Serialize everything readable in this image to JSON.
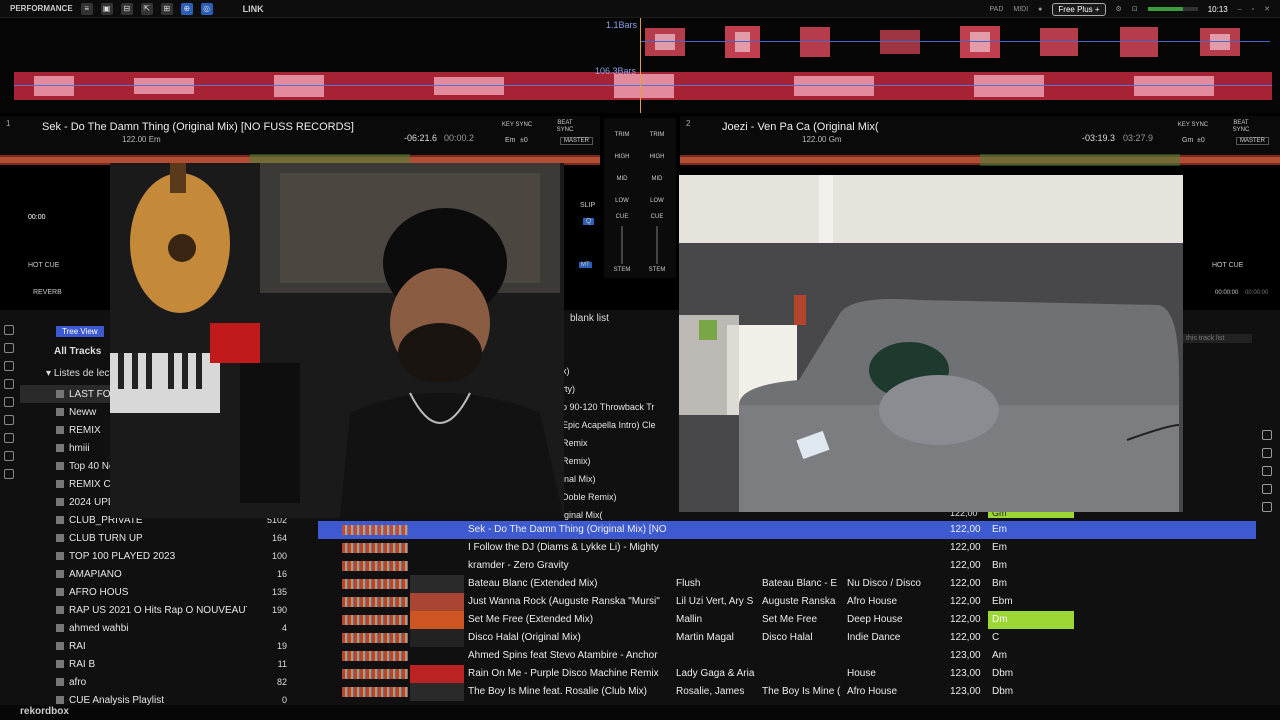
{
  "topbar": {
    "mode": "PERFORMANCE",
    "link_label": "LINK",
    "pad_label": "PAD",
    "midi_label": "MIDI",
    "plan_label": "Free Plus +",
    "clock": "10:13"
  },
  "overview": {
    "bars_top": "1.1Bars",
    "bars_bottom": "106.3Bars"
  },
  "deck1": {
    "number": "1",
    "title": "Sek - Do The Damn Thing (Original Mix) [NO FUSS RECORDS]",
    "bpm_key": "122.00 Em",
    "remaining": "-06:21.6",
    "elapsed": "00:00.2",
    "key_display": "Em",
    "key_offset": "±0",
    "key_sync": "KEY SYNC",
    "beat_sync": "BEAT SYNC",
    "master": "MASTER",
    "hot_cue": "HOT CUE",
    "reverb": "REVERB",
    "cue_time": "00:00",
    "slip": "SLIP",
    "q": "Q",
    "mt": "MT"
  },
  "deck2": {
    "number": "2",
    "title": "Joezi - Ven Pa Ca (Original Mix(",
    "bpm_key": "122.00 Gm",
    "remaining": "-03:19.3",
    "elapsed": "03:27.9",
    "key_display": "Gm",
    "key_offset": "±0",
    "key_sync": "KEY SYNC",
    "beat_sync": "BEAT SYNC",
    "master": "MASTER",
    "hot_cue": "HOT CUE",
    "time_a": "00:00:00",
    "time_b": "00:00:00"
  },
  "mixer": {
    "trim": "TRIM",
    "high": "HIGH",
    "mid": "MID",
    "low": "LOW",
    "cue": "CUE",
    "stem": "STEM"
  },
  "browser": {
    "tree_view": "Tree View",
    "all_tracks": "All Tracks",
    "playlists_header": "Listes de lectu",
    "blank_list": "blank list",
    "search_placeholder": "this track list",
    "playlists": [
      {
        "name": "LAST FO",
        "count": ""
      },
      {
        "name": "Neww",
        "count": ""
      },
      {
        "name": "REMIX",
        "count": ""
      },
      {
        "name": "hmiii",
        "count": ""
      },
      {
        "name": "Top 40 Ne",
        "count": ""
      },
      {
        "name": "REMIX CL",
        "count": ""
      },
      {
        "name": "2024 UPD",
        "count": ""
      },
      {
        "name": "CLUB_PRIVATE",
        "count": "5102"
      },
      {
        "name": "CLUB TURN UP",
        "count": "164"
      },
      {
        "name": "TOP 100 PLAYED 2023",
        "count": "100"
      },
      {
        "name": "AMAPIANO",
        "count": "16"
      },
      {
        "name": "AFRO HOUS",
        "count": "135"
      },
      {
        "name": "RAP US 2021 O  Hits Rap O  NOUVEAUTES",
        "count": "190"
      },
      {
        "name": "ahmed wahbi",
        "count": "4"
      },
      {
        "name": "RAI",
        "count": "19"
      },
      {
        "name": "RAI B",
        "count": "11"
      },
      {
        "name": "afro",
        "count": "82"
      },
      {
        "name": "CUE Analysis Playlist",
        "count": "0"
      }
    ],
    "partial_titles": [
      "x)",
      "rty)",
      "p 90-120 Throwback Tr",
      "Epic Acapella Intro) Cle",
      "Remix",
      " Remix)",
      "inal Mix)",
      "Doble Remix)",
      "iginal Mix("
    ],
    "tracks": [
      {
        "title": "Sek - Do The Damn Thing (Original Mix) [NO",
        "artist": "",
        "album": "",
        "genre": "",
        "bpm": "122,00",
        "key": "Em"
      },
      {
        "title": "I Follow the DJ (Diams & Lykke Li) - Mighty",
        "artist": "",
        "album": "",
        "genre": "",
        "bpm": "122,00",
        "key": "Em"
      },
      {
        "title": "kramder - Zero Gravity",
        "artist": "",
        "album": "",
        "genre": "",
        "bpm": "122,00",
        "key": "Bm"
      },
      {
        "title": "Bateau Blanc (Extended Mix)",
        "artist": "Flush",
        "album": "Bateau Blanc - E",
        "genre": "Nu Disco / Disco",
        "bpm": "122,00",
        "key": "Bm"
      },
      {
        "title": "Just Wanna Rock (Auguste Ranska \"Mursi\"",
        "artist": "Lil Uzi Vert, Ary S",
        "album": "Auguste Ranska",
        "genre": "Afro House",
        "bpm": "122,00",
        "key": "Ebm"
      },
      {
        "title": "Set Me Free (Extended Mix)",
        "artist": "Mallin",
        "album": "Set Me Free",
        "genre": "Deep House",
        "bpm": "122,00",
        "key": "Dm"
      },
      {
        "title": "Disco Halal (Original Mix)",
        "artist": "Martin Magal",
        "album": "Disco Halal",
        "genre": "Indie Dance",
        "bpm": "122,00",
        "key": "C"
      },
      {
        "title": "Ahmed Spins feat Stevo Atambire -  Anchor",
        "artist": "",
        "album": "",
        "genre": "",
        "bpm": "123,00",
        "key": "Am"
      },
      {
        "title": "Rain On Me - Purple Disco Machine Remix",
        "artist": "Lady Gaga & Aria",
        "album": "",
        "genre": "House",
        "bpm": "123,00",
        "key": "Dbm"
      },
      {
        "title": "The Boy Is Mine feat. Rosalie (Club Mix)",
        "artist": "Rosalie, James",
        "album": "The Boy Is Mine (",
        "genre": "Afro House",
        "bpm": "123,00",
        "key": "Dbm"
      }
    ],
    "top_key_cell": "Gm"
  },
  "bottom": {
    "app_name": "rekordbox"
  },
  "colors": {
    "selected_row": "#3d5ad0",
    "key_highlight": "#9bd835",
    "accent_blue": "#2b5fb7"
  }
}
